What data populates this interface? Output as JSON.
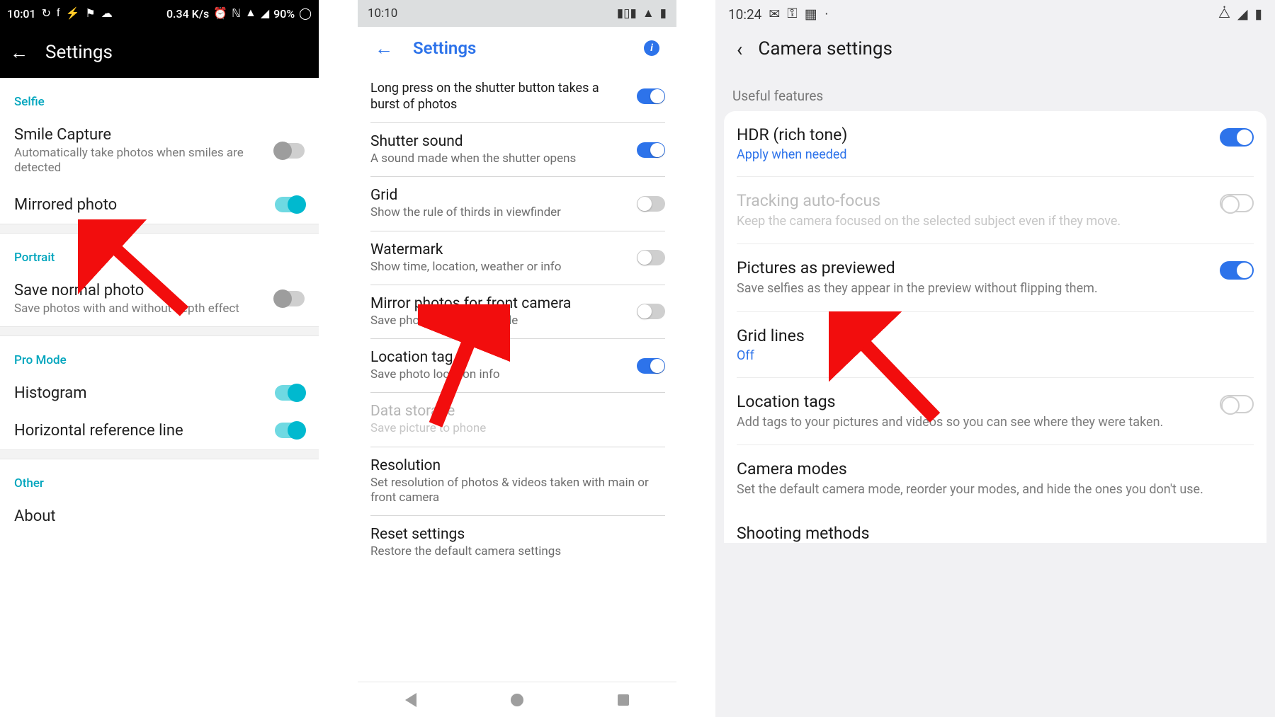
{
  "phone1": {
    "status": {
      "time": "10:01",
      "net": "0.34 K/s",
      "battery": "90%"
    },
    "appbar_title": "Settings",
    "sec_selfie": "Selfie",
    "smile_title": "Smile Capture",
    "smile_sub": "Automatically take photos when smiles are detected",
    "mirrored_title": "Mirrored photo",
    "sec_portrait": "Portrait",
    "save_normal_title": "Save normal photo",
    "save_normal_sub": "Save photos with and without depth effect",
    "sec_pro": "Pro Mode",
    "histogram_title": "Histogram",
    "horiz_title": "Horizontal reference line",
    "sec_other": "Other",
    "about_title": "About"
  },
  "phone2": {
    "status": {
      "time": "10:10"
    },
    "appbar_title": "Settings",
    "burst_sub": "Long press on the shutter button takes a burst of photos",
    "shutter_title": "Shutter sound",
    "shutter_sub": "A sound made when the shutter opens",
    "grid_title": "Grid",
    "grid_sub": "Show the rule of thirds in viewfinder",
    "wm_title": "Watermark",
    "wm_sub": "Show time, location, weather or info",
    "mirror_title": "Mirror photos for front camera",
    "mirror_sub": "Save photos in mirror mode",
    "loc_title": "Location tag",
    "loc_sub": "Save photo location info",
    "storage_title": "Data storage",
    "storage_sub": "Save picture to phone",
    "res_title": "Resolution",
    "res_sub": "Set resolution of photos & videos taken with main or front camera",
    "reset_title": "Reset settings",
    "reset_sub": "Restore the default camera settings"
  },
  "phone3": {
    "status": {
      "time": "10:24"
    },
    "appbar_title": "Camera settings",
    "sec_useful": "Useful features",
    "hdr_title": "HDR (rich tone)",
    "hdr_sub": "Apply when needed",
    "taf_title": "Tracking auto-focus",
    "taf_sub": "Keep the camera focused on the selected subject even if they move.",
    "pap_title": "Pictures as previewed",
    "pap_sub": "Save selfies as they appear in the preview without flipping them.",
    "gridlines_title": "Grid lines",
    "gridlines_sub": "Off",
    "ltags_title": "Location tags",
    "ltags_sub": "Add tags to your pictures and videos so you can see where they were taken.",
    "cmodes_title": "Camera modes",
    "cmodes_sub": "Set the default camera mode, reorder your modes, and hide the ones you don't use.",
    "shooting_title": "Shooting methods"
  }
}
